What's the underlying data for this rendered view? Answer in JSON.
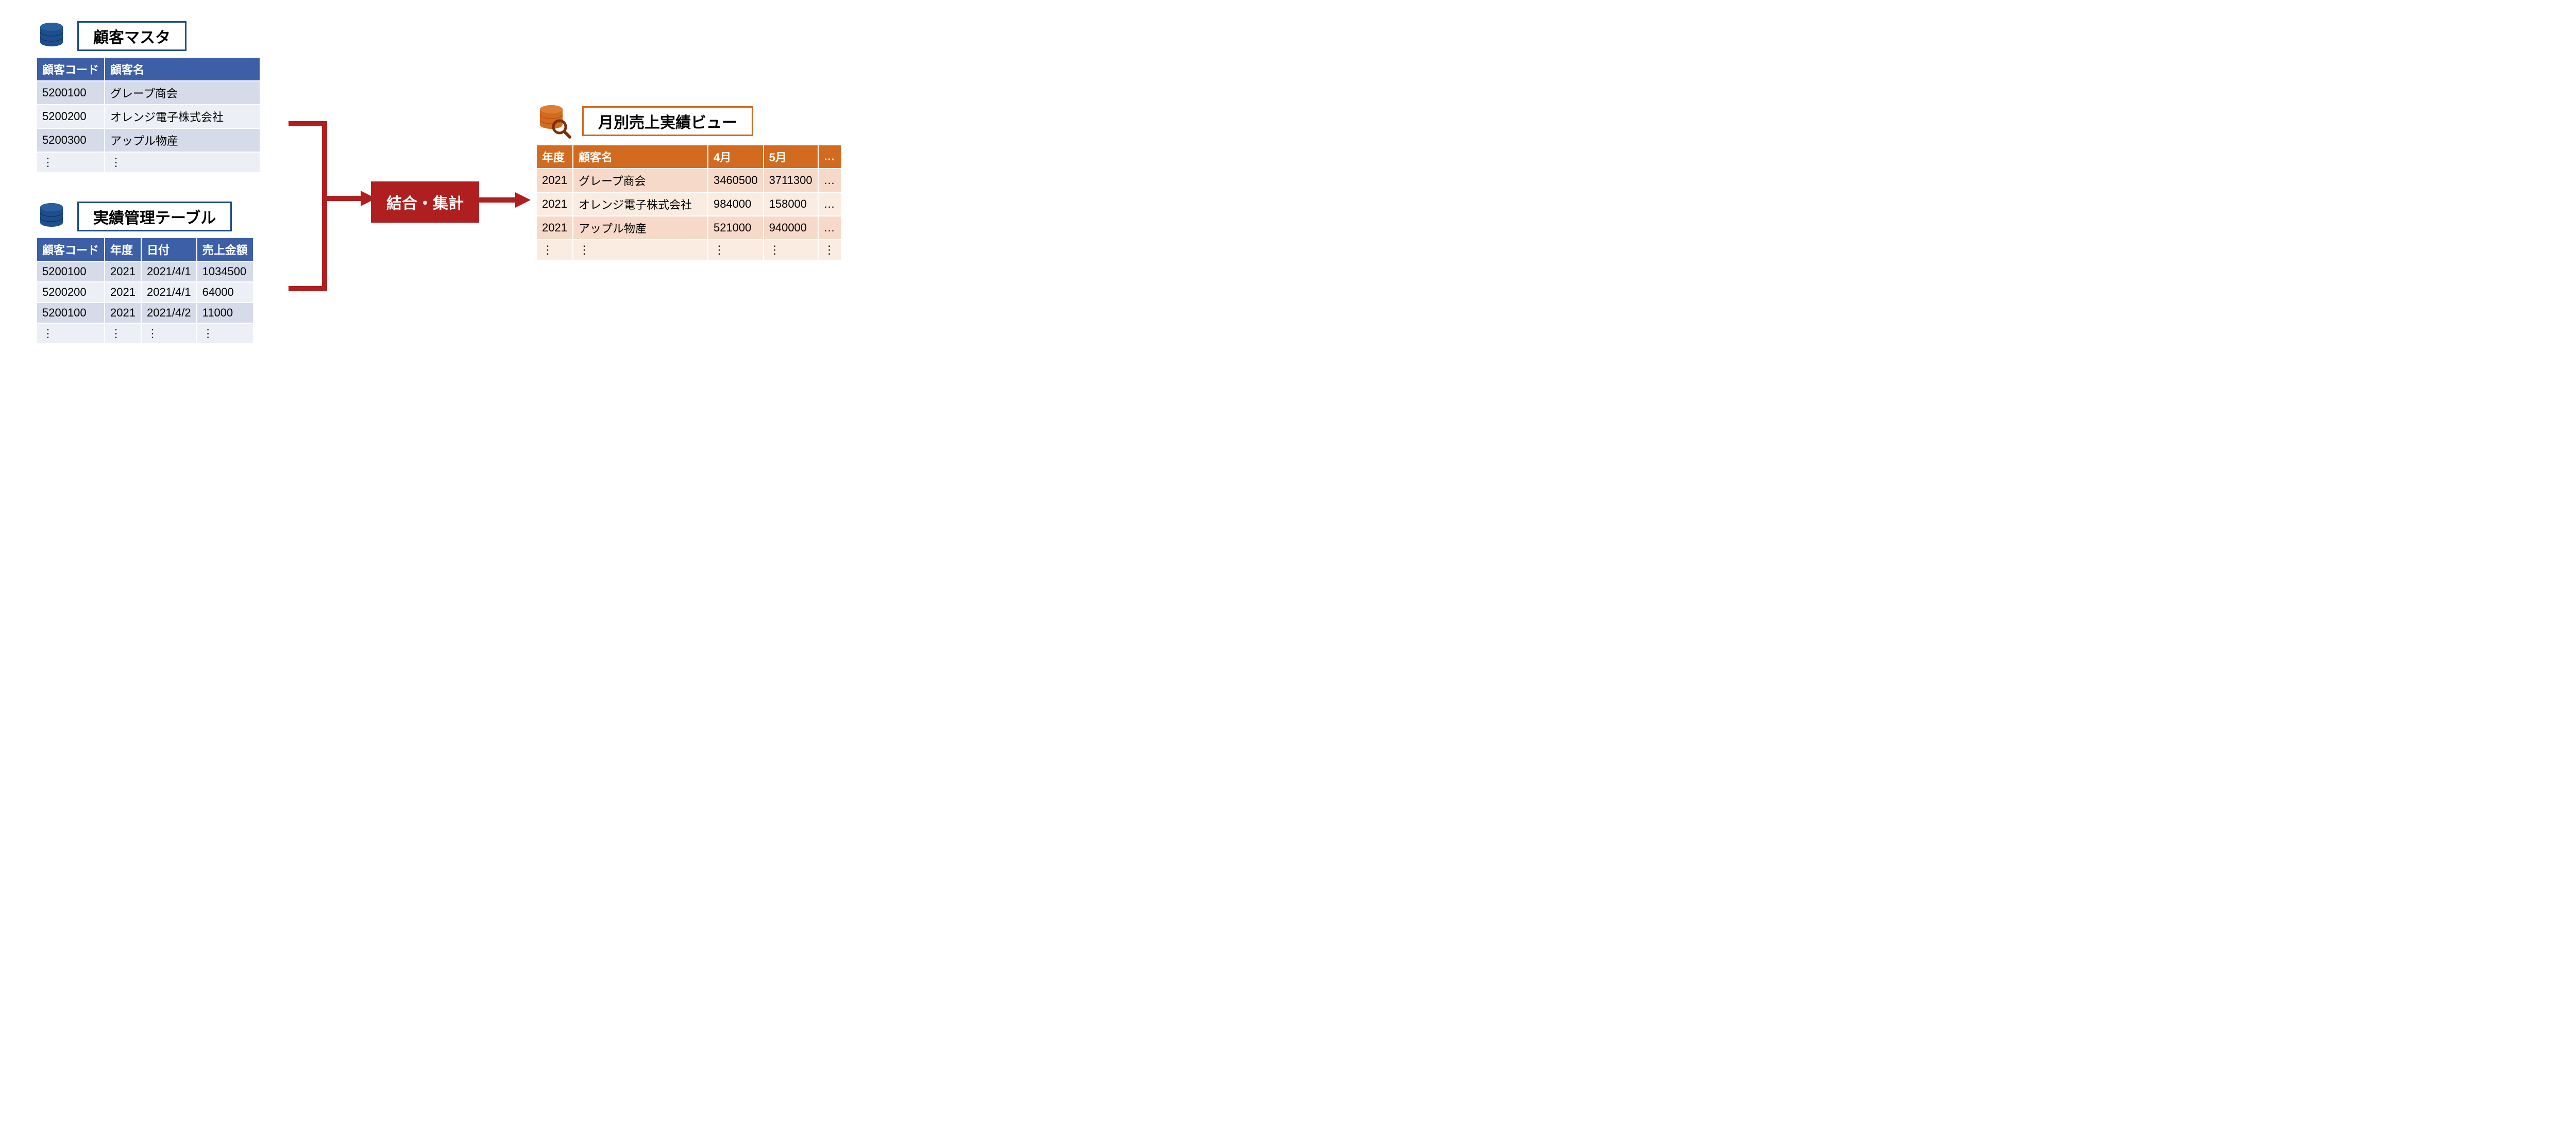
{
  "customer_master": {
    "title": "顧客マスタ",
    "columns": [
      "顧客コード",
      "顧客名"
    ],
    "rows": [
      [
        "5200100",
        "グレープ商会"
      ],
      [
        "5200200",
        "オレンジ電子株式会社"
      ],
      [
        "5200300",
        "アップル物産"
      ],
      [
        "⋮",
        "⋮"
      ]
    ]
  },
  "results_table": {
    "title": "実績管理テーブル",
    "columns": [
      "顧客コード",
      "年度",
      "日付",
      "売上金額"
    ],
    "rows": [
      [
        "5200100",
        "2021",
        "2021/4/1",
        "1034500"
      ],
      [
        "5200200",
        "2021",
        "2021/4/1",
        "64000"
      ],
      [
        "5200100",
        "2021",
        "2021/4/2",
        "11000"
      ],
      [
        "⋮",
        "⋮",
        "⋮",
        "⋮"
      ]
    ]
  },
  "merge_label": "結合・集計",
  "monthly_view": {
    "title": "月別売上実績ビュー",
    "columns": [
      "年度",
      "顧客名",
      "4月",
      "5月",
      "…"
    ],
    "rows": [
      [
        "2021",
        "グレープ商会",
        "3460500",
        "3711300",
        "…"
      ],
      [
        "2021",
        "オレンジ電子株式会社",
        "984000",
        "158000",
        "…"
      ],
      [
        "2021",
        "アップル物産",
        "521000",
        "940000",
        "…"
      ],
      [
        "⋮",
        "⋮",
        "⋮",
        "⋮",
        "⋮"
      ]
    ]
  },
  "colors": {
    "blue": "#1f4e8c",
    "blue_header": "#3d5fa8",
    "orange": "#d26b1f",
    "red": "#b01f1f"
  }
}
